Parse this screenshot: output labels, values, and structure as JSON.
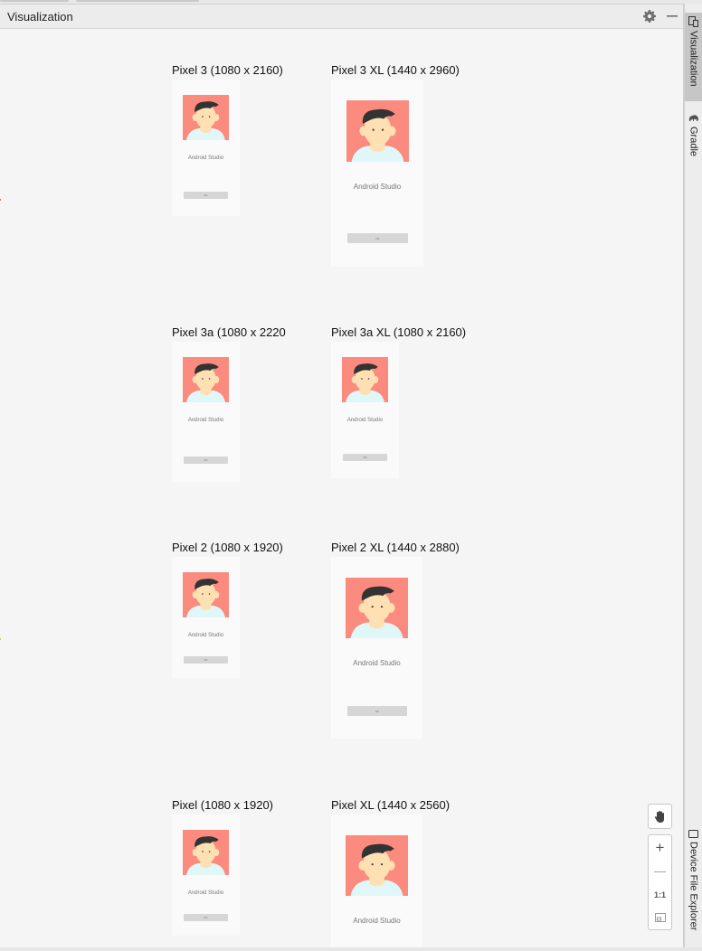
{
  "panel": {
    "title": "Visualization"
  },
  "header_icons": {
    "settings": "gear-icon",
    "minimize": "minimize-icon"
  },
  "devices": [
    {
      "label": "Pixel 3 (1080 x 2160)",
      "app_text": "Android Studio",
      "button_text": "OK"
    },
    {
      "label": "Pixel 3 XL (1440 x 2960)",
      "app_text": "Android Studio",
      "button_text": "OK"
    },
    {
      "label": "Pixel 3a (1080 x 2220)",
      "app_text": "Android Studio",
      "button_text": "OK"
    },
    {
      "label": "Pixel 3a XL (1080 x 2160)",
      "app_text": "Android Studio",
      "button_text": "OK"
    },
    {
      "label": "Pixel 2 (1080 x 1920)",
      "app_text": "Android Studio",
      "button_text": "OK"
    },
    {
      "label": "Pixel 2 XL (1440 x 2880)",
      "app_text": "Android Studio",
      "button_text": "OK"
    },
    {
      "label": "Pixel (1080 x 1920)",
      "app_text": "Android Studio",
      "button_text": "OK"
    },
    {
      "label": "Pixel XL (1440 x 2560)",
      "app_text": "Android Studio",
      "button_text": "OK"
    }
  ],
  "side_tabs": [
    {
      "label": "Visualization",
      "icon": "device-icon",
      "active": true
    },
    {
      "label": "Gradle",
      "icon": "gradle-elephant-icon",
      "active": false
    },
    {
      "label": "Device File Explorer",
      "icon": "phone-icon",
      "active": false
    }
  ],
  "zoom_controls": {
    "pan": "hand-icon",
    "zoom_in": "+",
    "zoom_out": "—",
    "actual_size": "1:1",
    "fit": "fit-screen-icon"
  },
  "colors": {
    "avatar_bg": "#fa8b7e",
    "skin": "#ffe0b2",
    "hair": "#333333",
    "shirt": "#e0f7fa"
  }
}
